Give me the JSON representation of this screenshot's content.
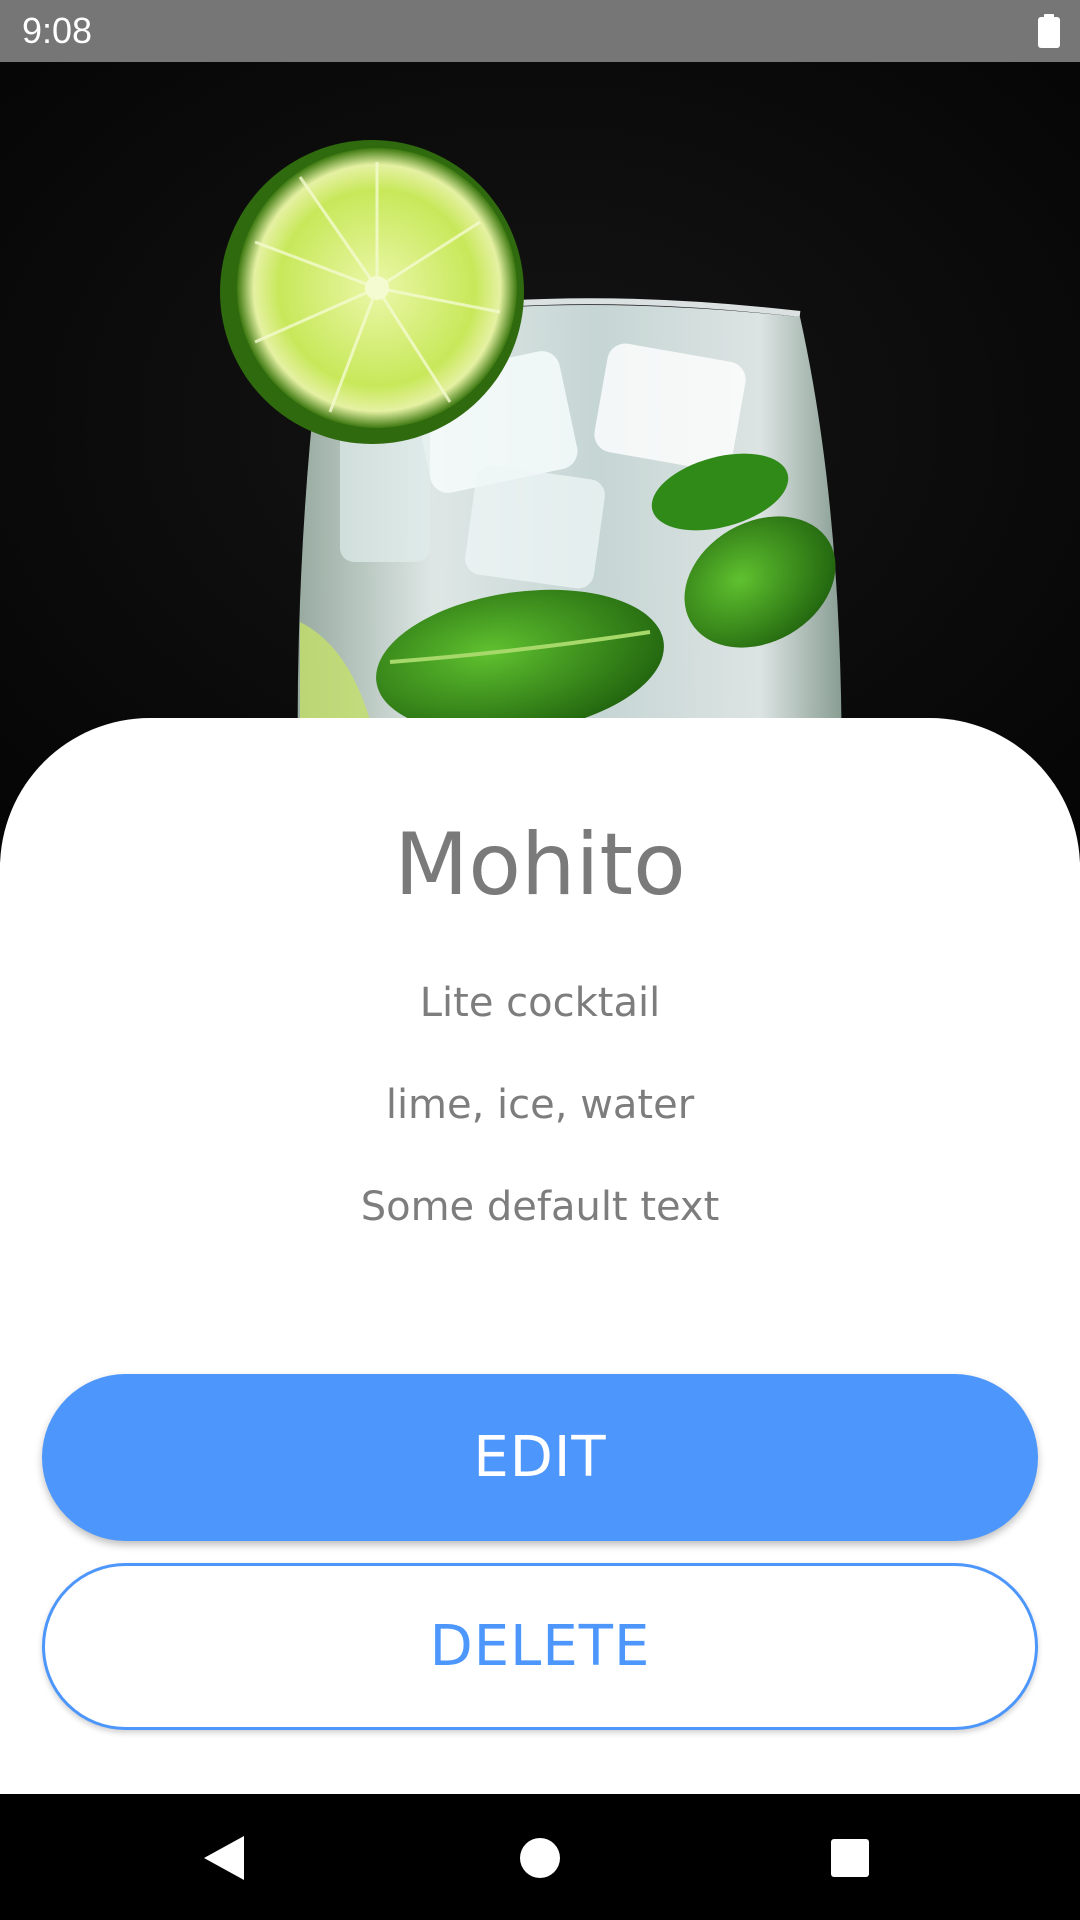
{
  "status_bar": {
    "time": "9:08",
    "battery_icon": "battery-full-icon"
  },
  "hero": {
    "image_subject": "mojito-glass-with-lime-and-mint"
  },
  "drink": {
    "name": "Mohito",
    "description": "Lite cocktail",
    "ingredients": "lime, ice, water",
    "notes": "Some default text"
  },
  "actions": {
    "edit_label": "EDIT",
    "delete_label": "DELETE"
  },
  "nav_bar": {
    "back_icon": "back-triangle-icon",
    "home_icon": "home-circle-icon",
    "recents_icon": "recents-square-icon"
  },
  "colors": {
    "accent": "#4c96fc",
    "status_bar": "#767676",
    "text_gray": "#7a7a7a"
  }
}
